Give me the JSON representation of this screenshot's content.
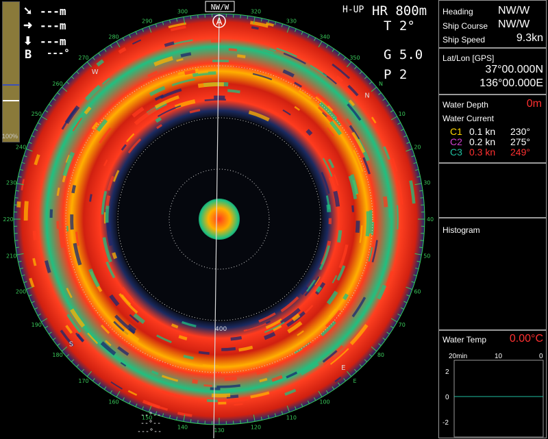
{
  "overlay": {
    "row1": "---m",
    "row2": "---m",
    "row3": "---m",
    "bearing_label": "B",
    "bearing_value": "---°",
    "gain_pct": "100%",
    "heading_box": "NW/W",
    "mode": "H-UP",
    "range": "HR 800m",
    "tilt": "T  2°",
    "gain": "G 5.0",
    "pulse": "P  2",
    "marker_a": "A",
    "range_mark": "400",
    "bottom_row1": "--°--",
    "bottom_row2": "--°--",
    "bottom_row3": "---°--"
  },
  "compass": {
    "directions": [
      "N",
      "E",
      "S",
      "W"
    ],
    "degrees": [
      "290",
      "300",
      "310",
      "320",
      "330",
      "340",
      "350",
      "N",
      "10",
      "20",
      "30",
      "40",
      "50",
      "60",
      "70",
      "80",
      "E",
      "100",
      "110",
      "120",
      "130",
      "140",
      "150",
      "160",
      "170",
      "180",
      "190",
      "200",
      "210",
      "220",
      "230",
      "240",
      "250",
      "260",
      "270",
      "280"
    ]
  },
  "panel": {
    "heading_label": "Heading",
    "heading_value": "NW/W",
    "course_label": "Ship Course",
    "course_value": "NW/W",
    "speed_label": "Ship Speed",
    "speed_value": "9.3kn",
    "latlon_label": "Lat/Lon [GPS]",
    "lat_value": "37°00.000N",
    "lon_value": "136°00.000E",
    "depth_label": "Water Depth",
    "depth_value": "0m",
    "current_label": "Water Current",
    "currents": [
      {
        "name": "C1",
        "speed": "0.1 kn",
        "dir": "230°",
        "name_color": "#ffd700",
        "dir_color": "#ffffff"
      },
      {
        "name": "C2",
        "speed": "0.2 kn",
        "dir": "275°",
        "name_color": "#d040d0",
        "dir_color": "#ffffff"
      },
      {
        "name": "C3",
        "speed": "0.3 kn",
        "dir": "249°",
        "name_color": "#20c0a0",
        "dir_color": "#ff3030"
      }
    ],
    "histogram_label": "Histogram",
    "temp_label": "Water Temp",
    "temp_value": "0.00°C",
    "temp_x_labels": [
      "20min",
      "10",
      "0"
    ],
    "temp_y_labels": [
      "2",
      "0",
      "-2"
    ]
  },
  "colors": {
    "echo_high": "#ff3b1e",
    "echo_mid": "#ffb000",
    "echo_low": "#20c080",
    "compass": "#39c95a",
    "alert": "#ff3030"
  }
}
